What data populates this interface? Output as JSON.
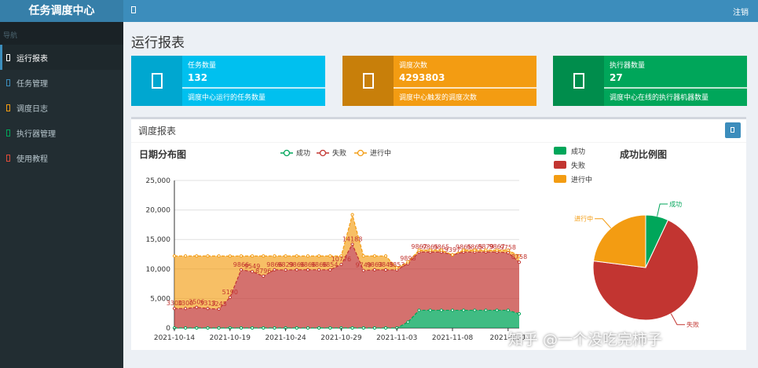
{
  "sidebar": {
    "title": "任务调度中心",
    "header": "导航",
    "items": [
      {
        "label": "运行报表"
      },
      {
        "label": "任务管理"
      },
      {
        "label": "调度日志"
      },
      {
        "label": "执行器管理"
      },
      {
        "label": "使用教程"
      }
    ]
  },
  "topbar": {
    "logout": "注销"
  },
  "page": {
    "title": "运行报表"
  },
  "boxes": [
    {
      "label": "任务数量",
      "value": "132",
      "desc": "调度中心运行的任务数量"
    },
    {
      "label": "调度次数",
      "value": "4293803",
      "desc": "调度中心触发的调度次数"
    },
    {
      "label": "执行器数量",
      "value": "27",
      "desc": "调度中心在线的执行器机器数量"
    }
  ],
  "panel": {
    "title": "调度报表"
  },
  "colors": {
    "success": "#00a65a",
    "fail": "#c23531",
    "running": "#f39c12"
  },
  "watermark": "知乎 @一个没吃完柿子",
  "chart_data": [
    {
      "type": "area",
      "title": "日期分布图",
      "stacked": true,
      "legend": [
        "成功",
        "失败",
        "进行中"
      ],
      "y_ticks": [
        "0",
        "5,000",
        "10,000",
        "15,000",
        "20,000",
        "25,000"
      ],
      "ylim": [
        0,
        25000
      ],
      "x_labels": [
        "2021-10-14",
        "2021-10-19",
        "2021-10-24",
        "2021-10-29",
        "2021-11-03",
        "2021-11-08",
        "2021-11-1"
      ],
      "x_label_indices": [
        0,
        5,
        10,
        15,
        20,
        25,
        30
      ],
      "series": [
        {
          "name": "成功",
          "values": [
            0,
            0,
            0,
            0,
            0,
            0,
            0,
            0,
            0,
            0,
            0,
            0,
            0,
            0,
            0,
            0,
            0,
            0,
            0,
            0,
            0,
            1000,
            3000,
            3000,
            3000,
            3000,
            3000,
            3000,
            3000,
            3000,
            3000,
            2400
          ]
        },
        {
          "name": "失败",
          "values": [
            3300,
            3300,
            3500,
            3300,
            3200,
            5190,
            9866,
            9549,
            8796,
            9866,
            9829,
            9866,
            9866,
            9866,
            9854,
            10776,
            14188,
            9749,
            9863,
            9845,
            9853,
            9898,
            9867,
            9865,
            9865,
            9397,
            9865,
            9865,
            9879,
            9867,
            9758,
            8758
          ]
        },
        {
          "name": "进行中",
          "values": [
            8900,
            8900,
            8700,
            8900,
            9000,
            7000,
            2334,
            2651,
            3400,
            2334,
            2371,
            2334,
            2334,
            2334,
            2346,
            1424,
            5012,
            2451,
            2337,
            2355,
            347,
            302,
            333,
            335,
            335,
            0,
            335,
            335,
            321,
            333,
            442,
            1042
          ]
        }
      ],
      "point_labels": [
        "3300",
        "3300",
        "3506",
        "3313",
        "3245",
        "5190",
        "9866",
        "9549",
        "8796",
        "9866",
        "9829",
        "9866",
        "9866",
        "9866",
        "9854",
        "10776",
        "14188",
        "9749",
        "9863",
        "9845",
        "9853",
        "9898",
        "9867",
        "9865",
        "9865",
        "9397",
        "9865",
        "9865",
        "9879",
        "9867",
        "9758",
        "8758"
      ]
    },
    {
      "type": "pie",
      "title": "成功比例图",
      "legend": [
        "成功",
        "失败",
        "进行中"
      ],
      "values": [
        7,
        70,
        23
      ]
    }
  ]
}
